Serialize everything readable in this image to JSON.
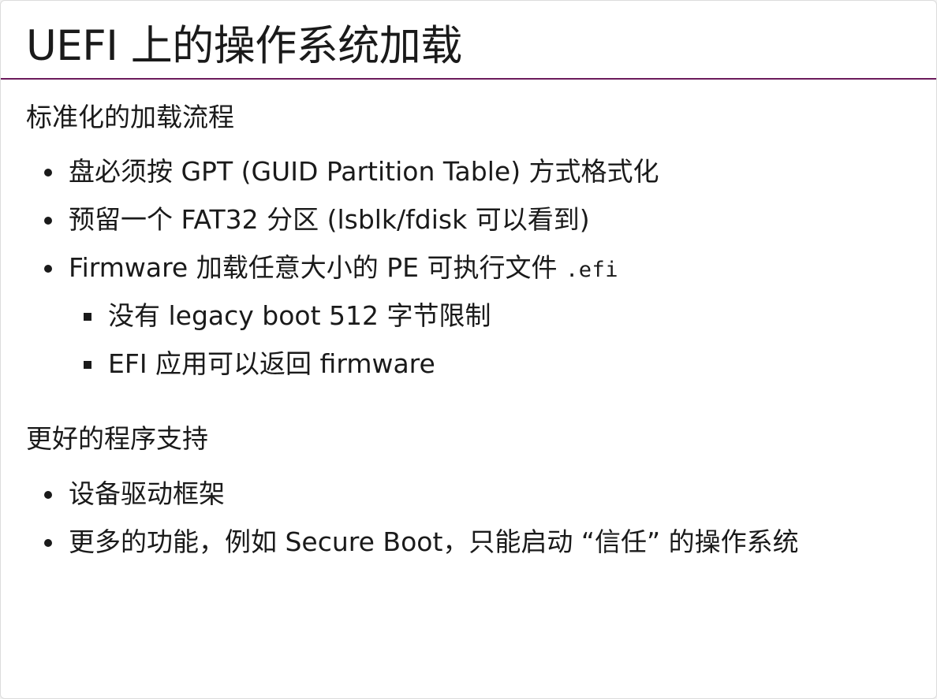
{
  "slide": {
    "title": "UEFI 上的操作系统加载",
    "sections": [
      {
        "heading": "标准化的加载流程",
        "items": [
          {
            "text": "盘必须按 GPT (GUID Partition Table) 方式格式化"
          },
          {
            "text": "预留一个 FAT32 分区 (lsblk/fdisk 可以看到)"
          },
          {
            "text": "Firmware 加载任意大小的 PE 可执行文件 ",
            "code": ".efi"
          },
          {
            "text": "没有 legacy boot 512 字节限制"
          },
          {
            "text": "EFI 应用可以返回 firmware"
          }
        ]
      },
      {
        "heading": "更好的程序支持",
        "items": [
          {
            "text": "设备驱动框架"
          },
          {
            "text": "更多的功能，例如 Secure Boot，只能启动 “信任” 的操作系统"
          }
        ]
      }
    ]
  }
}
